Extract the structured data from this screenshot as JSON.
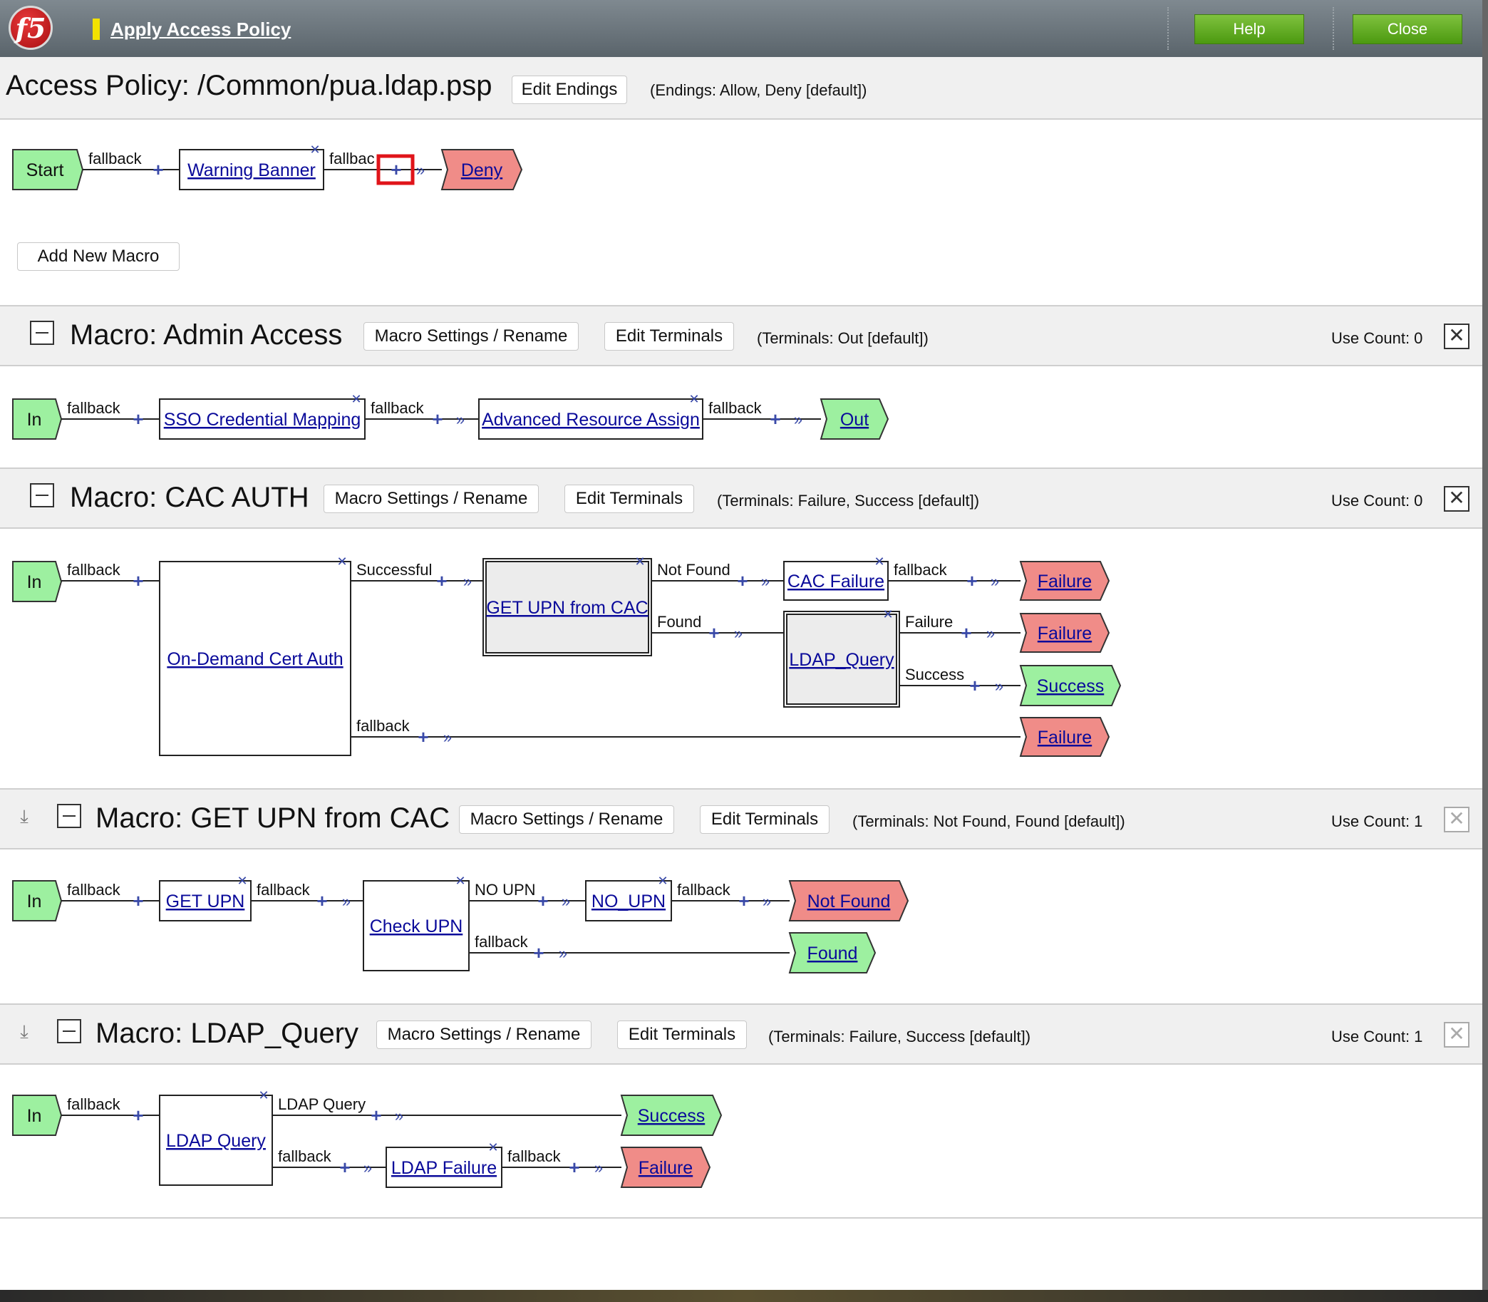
{
  "window": {
    "title": "Apply Access Policy",
    "logo_text": "f5",
    "help_label": "Help",
    "close_label": "Close"
  },
  "policy": {
    "title": "Access Policy: /Common/pua.ldap.psp",
    "edit_endings_label": "Edit Endings",
    "endings_note": "(Endings: Allow, Deny [default])",
    "add_macro_label": "Add New Macro"
  },
  "common": {
    "settings_label": "Macro Settings / Rename",
    "edit_terminals_label": "Edit Terminals",
    "close_glyph": "✕",
    "expand_glyph": "⤓"
  },
  "flows": {
    "main": {
      "nodes": [
        "Start",
        "Warning Banner",
        "Deny"
      ],
      "branches": [
        "fallback",
        "fallbac"
      ]
    },
    "admin": {
      "nodes": [
        "In",
        "SSO Credential Mapping",
        "Advanced Resource Assign",
        "Out"
      ],
      "branches": [
        "fallback"
      ]
    },
    "cac": {
      "nodes": [
        "In",
        "On-Demand Cert Auth",
        "GET UPN from CAC",
        "CAC Failure",
        "LDAP_Query",
        "Failure",
        "Success"
      ],
      "branches": [
        "fallback",
        "Successful",
        "Not Found",
        "Found",
        "Failure",
        "Success"
      ]
    },
    "upn": {
      "nodes": [
        "In",
        "GET UPN",
        "Check UPN",
        "NO_UPN",
        "Not Found",
        "Found"
      ],
      "branches": [
        "fallback",
        "NO UPN"
      ]
    },
    "ldap": {
      "nodes": [
        "In",
        "LDAP Query",
        "LDAP Failure",
        "Success",
        "Failure"
      ],
      "branches": [
        "fallback",
        "LDAP Query"
      ]
    }
  },
  "macros": [
    {
      "title": "Macro: Admin Access",
      "terminals_note": "(Terminals: Out [default])",
      "use_count": "Use Count: 0"
    },
    {
      "title": "Macro: CAC AUTH",
      "terminals_note": "(Terminals: Failure, Success [default])",
      "use_count": "Use Count: 0"
    },
    {
      "title": "Macro: GET UPN from CAC",
      "terminals_note": "(Terminals: Not Found, Found [default])",
      "use_count": "Use Count: 1"
    },
    {
      "title": "Macro: LDAP_Query",
      "terminals_note": "(Terminals: Failure, Success [default])",
      "use_count": "Use Count: 1"
    }
  ],
  "colors": {
    "start_green": "#9df0a0",
    "terminal_red": "#f08c88",
    "link_blue": "#0a0a9a",
    "button_green": "#5fae22",
    "highlight_red": "#e0141a"
  }
}
